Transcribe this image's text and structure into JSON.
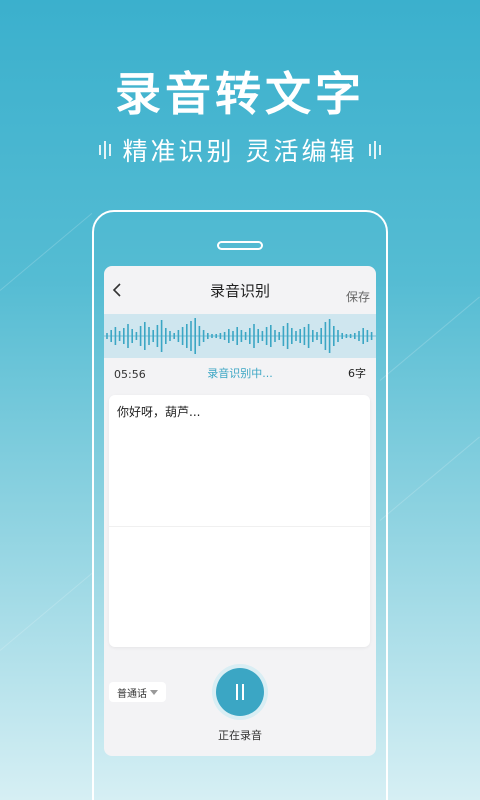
{
  "hero": {
    "title": "录音转文字",
    "subtitle": "精准识别 灵活编辑"
  },
  "nav": {
    "back_icon": "chevron-left-icon",
    "title": "录音识别",
    "save_label": "保存"
  },
  "status": {
    "elapsed": "05:56",
    "recognizing": "录音识别中...",
    "char_count": "6字"
  },
  "transcript": {
    "text": "你好呀，葫芦..."
  },
  "footer": {
    "language": "普通话",
    "dropdown_icon": "triangle-down-icon",
    "record_icon": "pause-icon",
    "record_label": "正在录音"
  },
  "colors": {
    "accent": "#3ba6c4",
    "waveform": "#3ba6c4",
    "waveform_bg": "#cfe6ef"
  }
}
